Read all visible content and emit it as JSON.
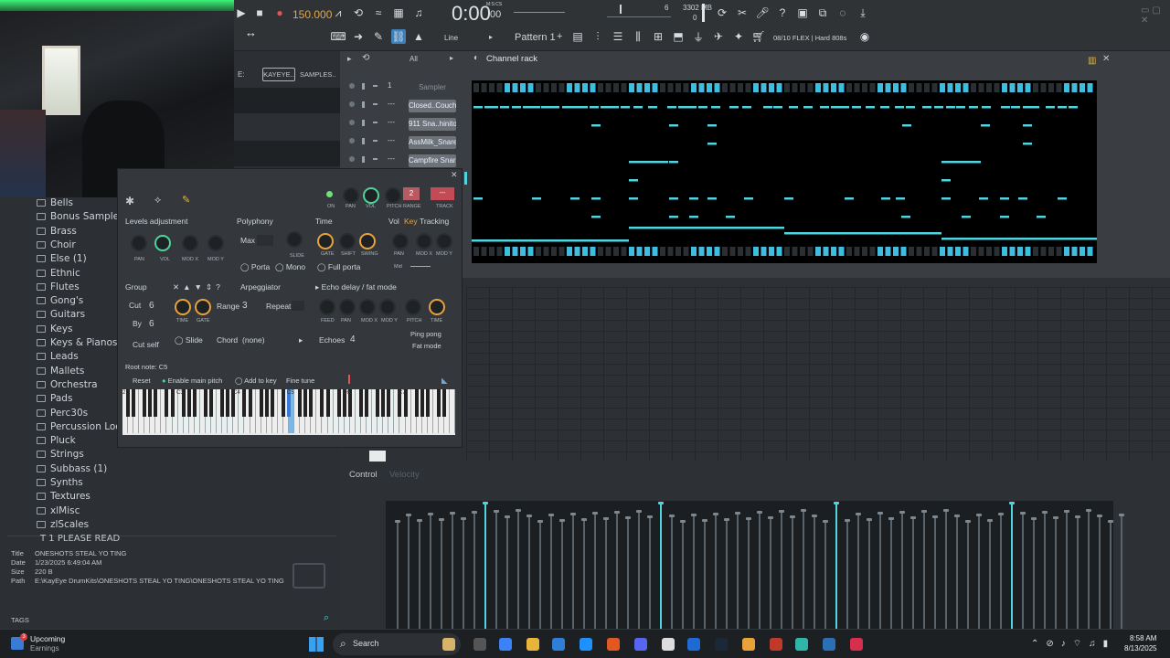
{
  "transport": {
    "tempo": "150.000",
    "time": "0:00",
    "time_small": "00",
    "time_label": "M:S:CS",
    "cpu": "6",
    "mem": "3302 MB",
    "mem2": "0"
  },
  "toolbar2": {
    "snap": "Line",
    "pattern": "Pattern 1",
    "preset": "08/10  FLEX | Hard 808s"
  },
  "browser": {
    "tab_e": "E:",
    "tab_kayeye": "KAYEYE..",
    "tab_samples": "SAMPLES..",
    "items": [
      "Bells",
      "Bonus Samples",
      "Brass",
      "Choir",
      "Else (1)",
      "Ethnic",
      "Flutes",
      "Gong's",
      "Guitars",
      "Keys",
      "Keys & Pianos",
      "Leads",
      "Mallets",
      "Orchestra",
      "Pads",
      "Perc30s",
      "Percussion Loops",
      "Pluck",
      "Strings",
      "Subbass (1)",
      "Synths",
      "Textures",
      "xlMisc",
      "zlScales"
    ],
    "please_read": "1 PLEASE READ",
    "info_title_key": "Title",
    "info_title": "ONESHOTS STEAL YO TING",
    "info_date_key": "Date",
    "info_date": "1/23/2025 6:49:04 AM",
    "info_size_key": "Size",
    "info_size": "220 B",
    "info_path_key": "Path",
    "info_path": "E:\\KayEye DrumKits\\ONESHOTS STEAL YO TING\\ONESHOTS STEAL YO TING",
    "tags": "TAGS"
  },
  "channel_rack": {
    "title": "Channel rack",
    "filter": "All",
    "channels": [
      {
        "num": "1",
        "name": "Sampler"
      },
      {
        "num": "---",
        "name": "Closed..Couch)"
      },
      {
        "num": "---",
        "name": "911 Sna..hinito)"
      },
      {
        "num": "---",
        "name": "AssMilk_Snare"
      },
      {
        "num": "---",
        "name": "Campfire Snare"
      }
    ]
  },
  "plugin": {
    "track_num": "2",
    "track_label": "TRACK",
    "track_value": "---",
    "top_knobs": [
      "ON",
      "PAN",
      "VOL",
      "PITCH",
      "RANGE"
    ],
    "levels_title": "Levels adjustment",
    "levels_knobs": [
      "PAN",
      "VOL",
      "MOD X",
      "MOD Y"
    ],
    "poly_title": "Polyphony",
    "poly_max": "Max",
    "poly_slide": "SLIDE",
    "porta": "Porta",
    "mono": "Mono",
    "time_title": "Time",
    "time_knobs": [
      "GATE",
      "SHIFT",
      "SWING"
    ],
    "full_porta": "Full porta",
    "vol": "Vol",
    "key": "Key",
    "tracking": "Tracking",
    "tracking_knobs": [
      "PAN",
      "MOD X",
      "MOD Y"
    ],
    "mid": "Mid",
    "group": "Group",
    "cut": "Cut",
    "cut_val": "6",
    "by": "By",
    "by_val": "6",
    "cut_self": "Cut self",
    "arp_knobs": [
      "TIME",
      "GATE"
    ],
    "range": "Range",
    "range_val": "3",
    "repeat": "Repeat",
    "arpeggiator": "Arpeggiator",
    "slide": "Slide",
    "chord": "Chord",
    "chord_val": "(none)",
    "echo_title": "Echo delay / fat mode",
    "echo_knobs": [
      "FEED",
      "PAN",
      "MOD X",
      "MOD Y",
      "PITCH",
      "TIME"
    ],
    "echoes": "Echoes",
    "echoes_val": "4",
    "ping_pong": "Ping pong",
    "fat_mode": "Fat mode",
    "root_note": "Root note: C5",
    "reset": "Reset",
    "enable_main_pitch": "Enable main pitch",
    "add_to_key": "Add to key",
    "fine_tune": "Fine tune",
    "octaves": [
      "2",
      "C3",
      "C4",
      "C5",
      "C6",
      "C7"
    ]
  },
  "piano_roll": {
    "control": "Control",
    "velocity": "Velocity"
  },
  "taskbar": {
    "weather_title": "Upcoming",
    "weather_sub": "Earnings",
    "badge": "3",
    "search": "Search",
    "time": "8:58 AM",
    "date": "8/13/2025"
  },
  "colors": {
    "accent": "#4fd4e0",
    "orange": "#e8a23a",
    "green": "#4fd49a"
  }
}
